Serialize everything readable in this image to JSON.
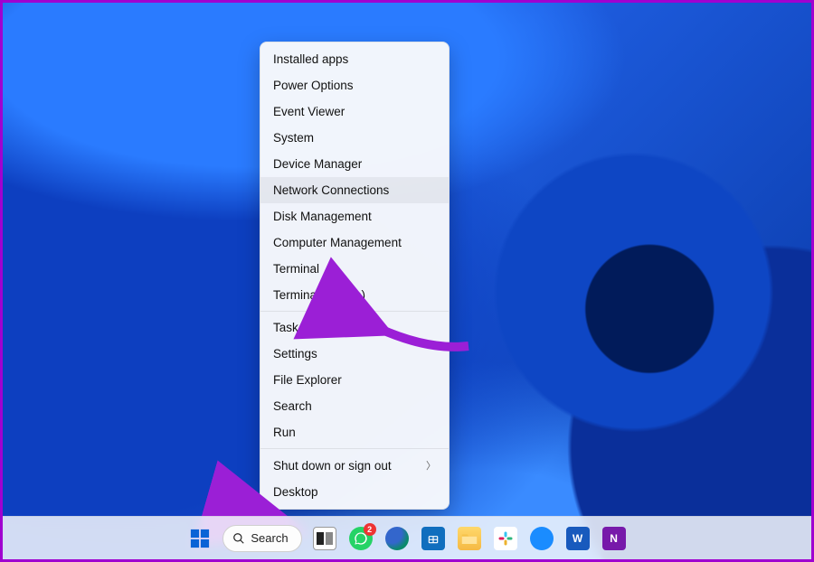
{
  "search": {
    "label": "Search"
  },
  "menu": {
    "items": [
      {
        "label": "Installed apps"
      },
      {
        "label": "Power Options"
      },
      {
        "label": "Event Viewer"
      },
      {
        "label": "System"
      },
      {
        "label": "Device Manager"
      },
      {
        "label": "Network Connections",
        "hover": true
      },
      {
        "label": "Disk Management"
      },
      {
        "label": "Computer Management"
      },
      {
        "label": "Terminal"
      },
      {
        "label": "Terminal (Admin)"
      }
    ],
    "items2": [
      {
        "label": "Task Manager"
      },
      {
        "label": "Settings"
      },
      {
        "label": "File Explorer"
      },
      {
        "label": "Search"
      },
      {
        "label": "Run"
      }
    ],
    "items3": [
      {
        "label": "Shut down or sign out",
        "sub": true
      },
      {
        "label": "Desktop"
      }
    ]
  },
  "taskbar": {
    "whatsapp_badge": "2"
  },
  "annotation": {
    "accent": "#9b1fd6"
  }
}
